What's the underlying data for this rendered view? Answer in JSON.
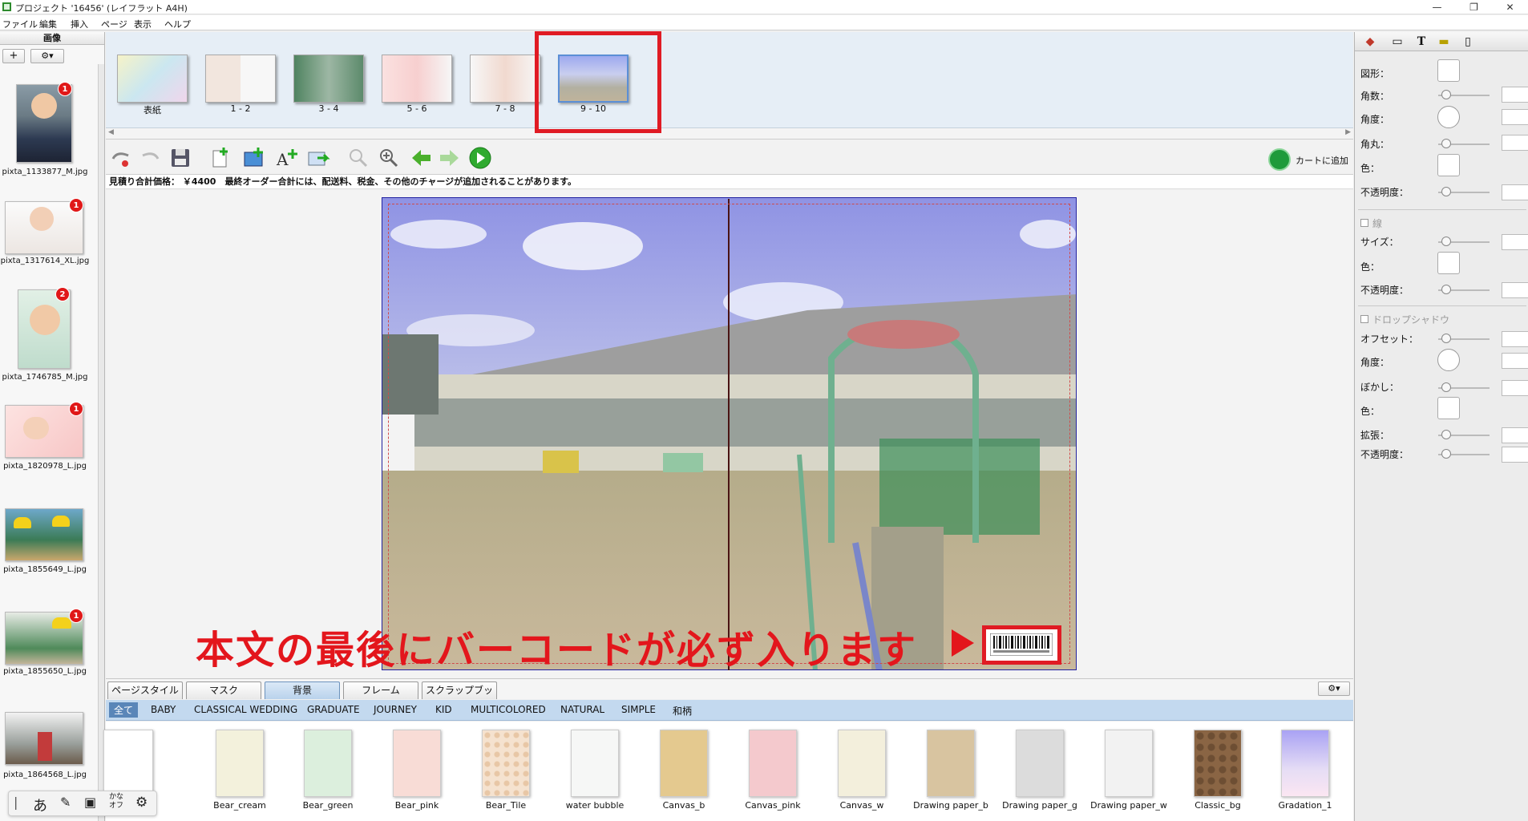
{
  "window": {
    "title": "プロジェクト '16456' (レイフラット A4H)",
    "min_icon": "minimize-icon",
    "max_icon": "restore-icon",
    "close_icon": "close-icon"
  },
  "menu": [
    "ファイル",
    "編集",
    "挿入",
    "ページ",
    "表示",
    "ヘルプ"
  ],
  "left_panel": {
    "title": "画像",
    "add_label": "+",
    "settings_label": "⚙▾",
    "images": [
      {
        "name": "pixta_1133877_M.jpg",
        "badge": "1"
      },
      {
        "name": "pixta_1317614_XL.jpg",
        "badge": "1"
      },
      {
        "name": "pixta_1746785_M.jpg",
        "badge": "2"
      },
      {
        "name": "pixta_1820978_L.jpg",
        "badge": "1"
      },
      {
        "name": "pixta_1855649_L.jpg",
        "badge": ""
      },
      {
        "name": "pixta_1855650_L.jpg",
        "badge": "1"
      },
      {
        "name": "pixta_1864568_L.jpg",
        "badge": ""
      }
    ]
  },
  "pages": [
    "表紙",
    "1 - 2",
    "3 - 4",
    "5 - 6",
    "7 - 8",
    "9 - 10"
  ],
  "selected_page": "9 - 10",
  "toolbar": {
    "cart_label": "カートに追加"
  },
  "price_text": "見積り合計価格： ￥4400　最終オーダー合計には、配送料、税金、その他のチャージが追加されることがあります。",
  "annotation": "本文の最後にバーコードが必ず入ります",
  "bottom_tabs": [
    "ページスタイル",
    "マスク",
    "背景",
    "フレーム",
    "スクラップブック"
  ],
  "active_tab": "背景",
  "categories": [
    "全て",
    "BABY",
    "CLASSICAL WEDDING",
    "GRADUATE",
    "JOURNEY",
    "KID",
    "MULTICOLORED",
    "NATURAL",
    "SIMPLE",
    "和柄"
  ],
  "papers": [
    {
      "label": "",
      "color": "#ffffff"
    },
    {
      "label": "Bear_cream",
      "color": "#f3f1dc"
    },
    {
      "label": "Bear_green",
      "color": "#dcefdd"
    },
    {
      "label": "Bear_pink",
      "color": "#f8dcd6"
    },
    {
      "label": "Bear_Tile",
      "color": "#f2d8c0"
    },
    {
      "label": "water bubble",
      "color": "#f6f7f6"
    },
    {
      "label": "Canvas_b",
      "color": "#e4c98f"
    },
    {
      "label": "Canvas_pink",
      "color": "#f4c9cd"
    },
    {
      "label": "Canvas_w",
      "color": "#f3efdc"
    },
    {
      "label": "Drawing paper_b",
      "color": "#d8c4a0"
    },
    {
      "label": "Drawing paper_g",
      "color": "#dcdcdc"
    },
    {
      "label": "Drawing paper_w",
      "color": "#f2f2f2"
    },
    {
      "label": "Classic_bg",
      "color": "#8a6544"
    },
    {
      "label": "Gradation_1",
      "color": "#b7b3f6"
    }
  ],
  "props": {
    "shape": "図形：",
    "corners": "角数：",
    "angle": "角度：",
    "rounded": "角丸：",
    "color": "色：",
    "opacity": "不透明度：",
    "line": "線",
    "size": "サイズ：",
    "line_color": "色：",
    "line_opacity": "不透明度：",
    "dropshadow": "ドロップシャドウ",
    "offset": "オフセット：",
    "shadow_angle": "角度：",
    "blur": "ぼかし：",
    "shadow_color": "色：",
    "expand": "拡張：",
    "shadow_opacity": "不透明度："
  },
  "ime": {
    "hira": "あ",
    "kana_top": "かな",
    "kana_bottom": "オフ"
  }
}
